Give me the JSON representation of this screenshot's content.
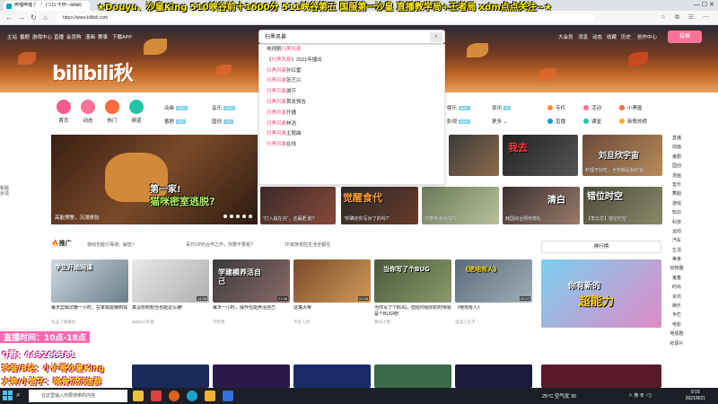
{
  "browser": {
    "tab_title": "哔哩哔哩 (゜-゜)つロ 干杯~-bilibili",
    "url": "https://www.bilibili.com",
    "window_controls": "—  ☐  ✕"
  },
  "stream_banner": "★Douyu、沙皇King  510峡谷前十1600分  511峡谷第五  国服第一沙皇  直播教学局+王者局  xdm点点关注~★",
  "header": {
    "logo_text": "bilibili秋",
    "nav_items": [
      "主站",
      "番剧",
      "游戏中心",
      "直播",
      "会员购",
      "漫画",
      "赛事",
      "下载APP"
    ],
    "right_items": [
      "大会员",
      "消息",
      "动态",
      "收藏",
      "历史",
      "创作中心"
    ],
    "upload_label": "投稿"
  },
  "search": {
    "query": "扫黑风暴",
    "suggestions": [
      {
        "pre": "电视剧",
        "hl": "扫黑风暴",
        "post": ""
      },
      {
        "pre": "《",
        "hl": "扫黑风暴",
        "post": "》2021年播出"
      },
      {
        "pre": "",
        "hl": "扫黑风暴",
        "post": "孙红雷"
      },
      {
        "pre": "",
        "hl": "扫黑风暴",
        "post": "张艺兴"
      },
      {
        "pre": "",
        "hl": "扫黑风暴",
        "post": "城节"
      },
      {
        "pre": "",
        "hl": "扫黑风暴",
        "post": "首发预告"
      },
      {
        "pre": "",
        "hl": "扫黑风暴",
        "post": "开播"
      },
      {
        "pre": "",
        "hl": "扫黑风暴",
        "post": "林浩"
      },
      {
        "pre": "",
        "hl": "扫黑风暴",
        "post": "主题曲"
      },
      {
        "pre": "",
        "hl": "扫黑风暴",
        "post": "在线"
      }
    ]
  },
  "categories": {
    "big": [
      {
        "label": "首页",
        "color": "#f25d8e"
      },
      {
        "label": "动态",
        "color": "#fb7299"
      },
      {
        "label": "热门",
        "color": "#ff6b3d"
      },
      {
        "label": "频道",
        "color": "#23c4a5"
      }
    ],
    "small": [
      "动画",
      "番剧",
      "国创",
      "音乐",
      "舞蹈",
      "游戏",
      "知识",
      "科技",
      "运动",
      "生活",
      "美食",
      "动物圈",
      "娱乐",
      "影视",
      "时尚",
      "资讯",
      "更多"
    ],
    "side": [
      "专栏",
      "活动",
      "小黑屋",
      "直播",
      "课堂",
      "新歌热榜"
    ]
  },
  "carousel": {
    "overlay_line1": "第一家!",
    "overlay_line2": "猫咪密室逃脱?",
    "title": "高能预警，沉浸体验"
  },
  "thumbs": [
    {
      "cap": "",
      "big": "我去"
    },
    {
      "cap": "",
      "big": ""
    },
    {
      "cap": "料理不好吃，全部都是我的错",
      "big": "刘旦欣宇宙"
    },
    {
      "cap": "“打入敌在内”，还赢肥 鹅?",
      "big": ""
    },
    {
      "cap": "“你确定你写对了的吗?”",
      "big": "觉醒食代"
    },
    {
      "cap": "你意味道完成的",
      "big": ""
    },
    {
      "cap": "韩国综合颁奖典礼",
      "big": "清白"
    },
    {
      "cap": "【李云龙】错位时空",
      "big": "错位时空"
    }
  ],
  "promo": {
    "title": "推广",
    "tags": [
      "游戏也能行得通，解密！",
      "百万UP的合作之作，你要不要看?",
      "TF家族冒险生活全都在"
    ],
    "ranking_label": "排行榜"
  },
  "videos": [
    {
      "title": "每天剪辑早晚一小时，在家就能赚到钱",
      "up": "毕业了能做啥",
      "dur": "",
      "img": "学生开始网课"
    },
    {
      "title": "真没想到想当也能这么赚!",
      "up": "Bilibili小作家",
      "dur": "14:58",
      "img": ""
    },
    {
      "title": "每天一小时，操作也能养活自己",
      "up": "学院君",
      "dur": "21:38",
      "img": "学建模养活自己"
    },
    {
      "title": "这嘴大帝",
      "up": "不甘人后",
      "dur": "01:48",
      "img": ""
    },
    {
      "title": "当你写了个BUG，但给你组织的时候就是个BUG吧!",
      "up": "我的小熊",
      "dur": "",
      "img": "当你写了个BUG"
    },
    {
      "title": "《绝地有人》",
      "up": "电竞小王子",
      "dur": "02:27",
      "img": "《绝地有人》"
    }
  ],
  "ad": {
    "line1": "你有新的",
    "line2": "超能力"
  },
  "right_nav": [
    "直播",
    "动画",
    "番剧",
    "国创",
    "漫画",
    "音乐",
    "舞蹈",
    "游戏",
    "知识",
    "科技",
    "运动",
    "汽车",
    "生活",
    "美食",
    "动物圈",
    "鬼畜",
    "时尚",
    "资讯",
    "娱乐",
    "专栏",
    "电影",
    "电视剧",
    "纪录片"
  ],
  "side_float": "新版反馈",
  "overlay": {
    "line1": "直播时间：10点-18点",
    "line2": "Q群：443265381",
    "line3": "抖音/B站：小沪哥沙皇King",
    "line4": "大神/小游子：晓骨沉沉信群"
  },
  "taskbar": {
    "search_placeholder": "在这里输入你要搜索的内容",
    "weather": "25°C 空气优 30",
    "tray": "∧  英  ⊕  ◁)",
    "time": "9:16",
    "date": "2021/8/21"
  },
  "colors": {
    "pink": "#fb7299",
    "blue": "#00a1d6"
  }
}
